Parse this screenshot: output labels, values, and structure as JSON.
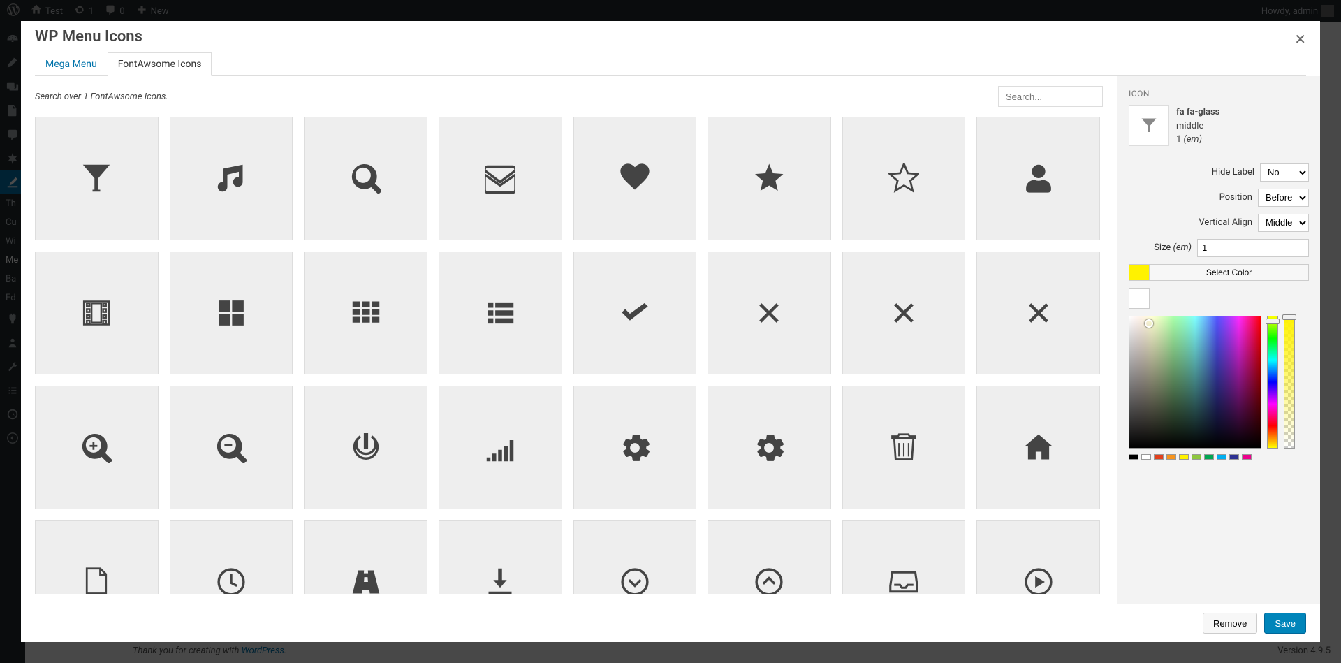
{
  "admin_bar": {
    "site_name": "Test",
    "updates_count": "1",
    "comments_count": "0",
    "new_label": "New",
    "greeting": "Howdy, admin"
  },
  "sidebar_submenu": [
    "Th",
    "Cu",
    "Wi",
    "Me",
    "Ba",
    "Ed"
  ],
  "footer": {
    "text_prefix": "Thank you for creating with ",
    "link_text": "WordPress",
    "version": "Version 4.9.5"
  },
  "modal": {
    "title": "WP Menu Icons",
    "tabs": {
      "mega": "Mega Menu",
      "fa": "FontAwsome Icons"
    },
    "search_hint": "Search over 1 FontAwsome Icons.",
    "search_placeholder": "Search...",
    "footer": {
      "remove": "Remove",
      "save": "Save"
    }
  },
  "icons": [
    "glass",
    "music",
    "search",
    "envelope",
    "heart",
    "star",
    "star-o",
    "user",
    "film",
    "th-large",
    "th",
    "th-list",
    "check",
    "times",
    "times",
    "times",
    "zoom-in",
    "zoom-out",
    "power-off",
    "signal",
    "cog",
    "cog",
    "trash",
    "home",
    "file",
    "clock",
    "road",
    "download",
    "circle-down",
    "circle-up",
    "inbox",
    "play-circle"
  ],
  "panel": {
    "section": "ICON",
    "icon_name": "fa fa-glass",
    "valign_value": "middle",
    "size_display_num": "1",
    "size_display_unit": "(em)",
    "hide_label": {
      "label": "Hide Label",
      "value": "No"
    },
    "position": {
      "label": "Position",
      "value": "Before"
    },
    "valign": {
      "label": "Vertical Align",
      "value": "Middle"
    },
    "size": {
      "label": "Size",
      "unit": "(em)",
      "value": "1"
    },
    "select_color": "Select Color",
    "swatch_color": "#fff200",
    "presets": [
      "#000000",
      "#ffffff",
      "#e2401c",
      "#f7941d",
      "#fff200",
      "#8dc63f",
      "#00a651",
      "#00aeef",
      "#2e3192",
      "#ec008c"
    ]
  }
}
